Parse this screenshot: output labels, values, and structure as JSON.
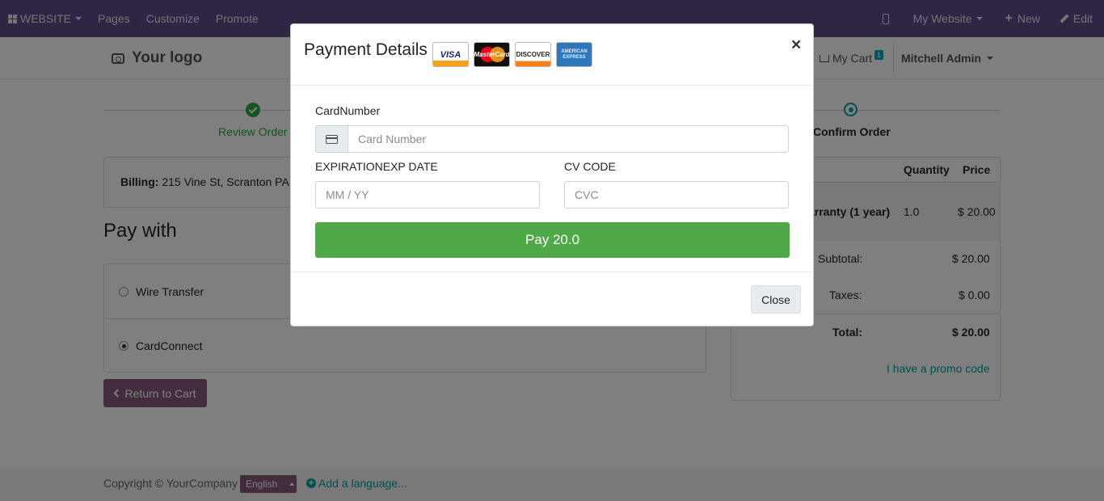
{
  "topbar": {
    "website": "WEBSITE",
    "pages": "Pages",
    "customize": "Customize",
    "promote": "Promote",
    "my_website": "My Website",
    "new": "New",
    "edit": "Edit"
  },
  "header": {
    "logo": "Your logo",
    "cart": "My Cart",
    "cart_count": "1",
    "user": "Mitchell Admin"
  },
  "progress": {
    "review": "Review Order",
    "confirm": "Confirm Order"
  },
  "billing": {
    "label": "Billing:",
    "address": "215 Vine St, Scranton PA"
  },
  "pay_with": {
    "title": "Pay with",
    "options": [
      {
        "label": "Wire Transfer",
        "checked": false
      },
      {
        "label": "CardConnect",
        "checked": true
      }
    ]
  },
  "return_button": "Return to Cart",
  "summary": {
    "col_quantity": "Quantity",
    "col_price": "Price",
    "product": "arranty (1 year)",
    "quantity": "1.0",
    "price": "$ 20.00",
    "subtotal_label": "Subtotal:",
    "subtotal": "$ 20.00",
    "taxes_label": "Taxes:",
    "taxes": "$ 0.00",
    "total_label": "Total:",
    "total": "$ 20.00",
    "promo": "I have a promo code"
  },
  "footer": {
    "copyright": "Copyright © YourCompany",
    "language": "English",
    "add_language": "Add a language..."
  },
  "modal": {
    "title": "Payment Details",
    "card_brands": [
      "VISA",
      "MasterCard",
      "DISCOVER",
      "AMERICAN EXPRESS"
    ],
    "card_number_label": "CardNumber",
    "card_number_placeholder": "Card Number",
    "exp_label": "EXPIRATIONEXP DATE",
    "exp_placeholder": "MM / YY",
    "cvc_label": "CV CODE",
    "cvc_placeholder": "CVC",
    "pay_button": "Pay 20.0",
    "close_button": "Close",
    "close_x": "×"
  },
  "colors": {
    "topbar": "#5f4a8b",
    "primary": "#875a7b",
    "success": "#28a745",
    "pay_button": "#4fa947",
    "teal": "#00a09d"
  }
}
